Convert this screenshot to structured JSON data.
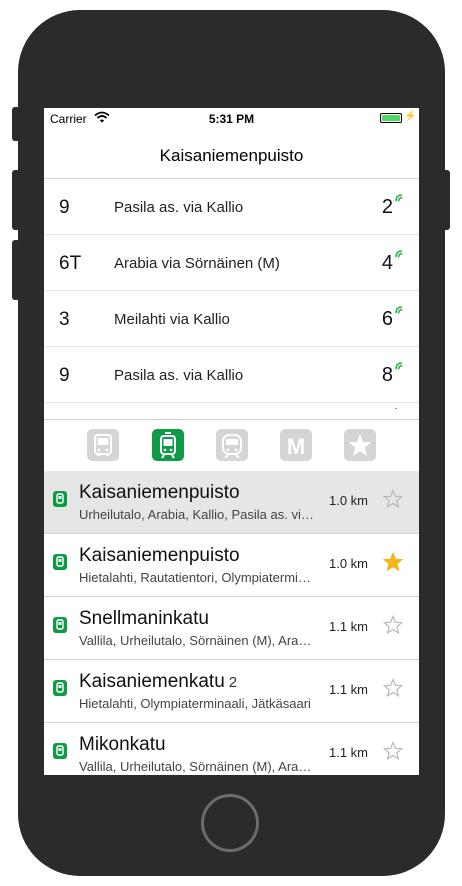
{
  "status_bar": {
    "carrier": "Carrier",
    "time": "5:31 PM"
  },
  "nav": {
    "title": "Kaisaniemenpuisto"
  },
  "departures": [
    {
      "route": "9",
      "destination": "Pasila as. via Kallio",
      "minutes": "2"
    },
    {
      "route": "6T",
      "destination": "Arabia via Sörnäinen (M)",
      "minutes": "4"
    },
    {
      "route": "3",
      "destination": "Meilahti via Kallio",
      "minutes": "6"
    },
    {
      "route": "9",
      "destination": "Pasila as. via Kallio",
      "minutes": "8"
    }
  ],
  "mode_tabs": [
    {
      "name": "bus",
      "active": false
    },
    {
      "name": "tram",
      "active": true
    },
    {
      "name": "train",
      "active": false
    },
    {
      "name": "metro",
      "label": "M",
      "active": false
    },
    {
      "name": "favorites",
      "active": false
    }
  ],
  "stops": [
    {
      "name": "Kaisaniemenpuisto",
      "platform": "",
      "lines": "Urheilutalo, Arabia, Kallio, Pasila as. via Kallio",
      "distance": "1.0 km",
      "favorite": false,
      "selected": true
    },
    {
      "name": "Kaisaniemenpuisto",
      "platform": "",
      "lines": "Hietalahti, Rautatientori, Olympiaterminaali",
      "distance": "1.0 km",
      "favorite": true,
      "selected": false
    },
    {
      "name": "Snellmaninkatu",
      "platform": "",
      "lines": "Vallila, Urheilutalo, Sörnäinen (M), Arabia",
      "distance": "1.1 km",
      "favorite": false,
      "selected": false
    },
    {
      "name": "Kaisaniemenkatu",
      "platform": "2",
      "lines": "Hietalahti, Olympiaterminaali, Jätkäsaari",
      "distance": "1.1 km",
      "favorite": false,
      "selected": false
    },
    {
      "name": "Mikonkatu",
      "platform": "",
      "lines": "Vallila, Urheilutalo, Sörnäinen (M), Arabia",
      "distance": "1.1 km",
      "favorite": false,
      "selected": false
    }
  ],
  "colors": {
    "accent": "#0e9b45",
    "favorite": "#f6b418",
    "inactive_tab": "#d5d5d5",
    "selected_row": "#e6e6e6"
  }
}
